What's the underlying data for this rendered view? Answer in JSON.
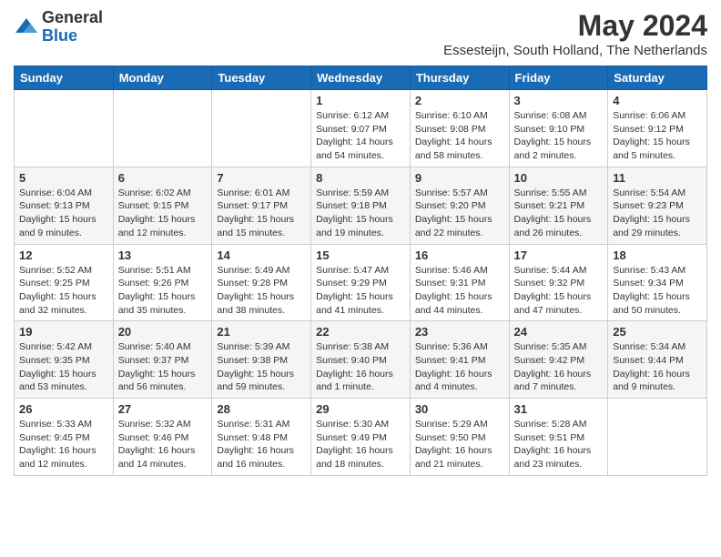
{
  "header": {
    "logo_line1": "General",
    "logo_line2": "Blue",
    "month_title": "May 2024",
    "location": "Essesteijn, South Holland, The Netherlands"
  },
  "days_of_week": [
    "Sunday",
    "Monday",
    "Tuesday",
    "Wednesday",
    "Thursday",
    "Friday",
    "Saturday"
  ],
  "weeks": [
    [
      {
        "day": "",
        "info": ""
      },
      {
        "day": "",
        "info": ""
      },
      {
        "day": "",
        "info": ""
      },
      {
        "day": "1",
        "info": "Sunrise: 6:12 AM\nSunset: 9:07 PM\nDaylight: 14 hours\nand 54 minutes."
      },
      {
        "day": "2",
        "info": "Sunrise: 6:10 AM\nSunset: 9:08 PM\nDaylight: 14 hours\nand 58 minutes."
      },
      {
        "day": "3",
        "info": "Sunrise: 6:08 AM\nSunset: 9:10 PM\nDaylight: 15 hours\nand 2 minutes."
      },
      {
        "day": "4",
        "info": "Sunrise: 6:06 AM\nSunset: 9:12 PM\nDaylight: 15 hours\nand 5 minutes."
      }
    ],
    [
      {
        "day": "5",
        "info": "Sunrise: 6:04 AM\nSunset: 9:13 PM\nDaylight: 15 hours\nand 9 minutes."
      },
      {
        "day": "6",
        "info": "Sunrise: 6:02 AM\nSunset: 9:15 PM\nDaylight: 15 hours\nand 12 minutes."
      },
      {
        "day": "7",
        "info": "Sunrise: 6:01 AM\nSunset: 9:17 PM\nDaylight: 15 hours\nand 15 minutes."
      },
      {
        "day": "8",
        "info": "Sunrise: 5:59 AM\nSunset: 9:18 PM\nDaylight: 15 hours\nand 19 minutes."
      },
      {
        "day": "9",
        "info": "Sunrise: 5:57 AM\nSunset: 9:20 PM\nDaylight: 15 hours\nand 22 minutes."
      },
      {
        "day": "10",
        "info": "Sunrise: 5:55 AM\nSunset: 9:21 PM\nDaylight: 15 hours\nand 26 minutes."
      },
      {
        "day": "11",
        "info": "Sunrise: 5:54 AM\nSunset: 9:23 PM\nDaylight: 15 hours\nand 29 minutes."
      }
    ],
    [
      {
        "day": "12",
        "info": "Sunrise: 5:52 AM\nSunset: 9:25 PM\nDaylight: 15 hours\nand 32 minutes."
      },
      {
        "day": "13",
        "info": "Sunrise: 5:51 AM\nSunset: 9:26 PM\nDaylight: 15 hours\nand 35 minutes."
      },
      {
        "day": "14",
        "info": "Sunrise: 5:49 AM\nSunset: 9:28 PM\nDaylight: 15 hours\nand 38 minutes."
      },
      {
        "day": "15",
        "info": "Sunrise: 5:47 AM\nSunset: 9:29 PM\nDaylight: 15 hours\nand 41 minutes."
      },
      {
        "day": "16",
        "info": "Sunrise: 5:46 AM\nSunset: 9:31 PM\nDaylight: 15 hours\nand 44 minutes."
      },
      {
        "day": "17",
        "info": "Sunrise: 5:44 AM\nSunset: 9:32 PM\nDaylight: 15 hours\nand 47 minutes."
      },
      {
        "day": "18",
        "info": "Sunrise: 5:43 AM\nSunset: 9:34 PM\nDaylight: 15 hours\nand 50 minutes."
      }
    ],
    [
      {
        "day": "19",
        "info": "Sunrise: 5:42 AM\nSunset: 9:35 PM\nDaylight: 15 hours\nand 53 minutes."
      },
      {
        "day": "20",
        "info": "Sunrise: 5:40 AM\nSunset: 9:37 PM\nDaylight: 15 hours\nand 56 minutes."
      },
      {
        "day": "21",
        "info": "Sunrise: 5:39 AM\nSunset: 9:38 PM\nDaylight: 15 hours\nand 59 minutes."
      },
      {
        "day": "22",
        "info": "Sunrise: 5:38 AM\nSunset: 9:40 PM\nDaylight: 16 hours\nand 1 minute."
      },
      {
        "day": "23",
        "info": "Sunrise: 5:36 AM\nSunset: 9:41 PM\nDaylight: 16 hours\nand 4 minutes."
      },
      {
        "day": "24",
        "info": "Sunrise: 5:35 AM\nSunset: 9:42 PM\nDaylight: 16 hours\nand 7 minutes."
      },
      {
        "day": "25",
        "info": "Sunrise: 5:34 AM\nSunset: 9:44 PM\nDaylight: 16 hours\nand 9 minutes."
      }
    ],
    [
      {
        "day": "26",
        "info": "Sunrise: 5:33 AM\nSunset: 9:45 PM\nDaylight: 16 hours\nand 12 minutes."
      },
      {
        "day": "27",
        "info": "Sunrise: 5:32 AM\nSunset: 9:46 PM\nDaylight: 16 hours\nand 14 minutes."
      },
      {
        "day": "28",
        "info": "Sunrise: 5:31 AM\nSunset: 9:48 PM\nDaylight: 16 hours\nand 16 minutes."
      },
      {
        "day": "29",
        "info": "Sunrise: 5:30 AM\nSunset: 9:49 PM\nDaylight: 16 hours\nand 18 minutes."
      },
      {
        "day": "30",
        "info": "Sunrise: 5:29 AM\nSunset: 9:50 PM\nDaylight: 16 hours\nand 21 minutes."
      },
      {
        "day": "31",
        "info": "Sunrise: 5:28 AM\nSunset: 9:51 PM\nDaylight: 16 hours\nand 23 minutes."
      },
      {
        "day": "",
        "info": ""
      }
    ]
  ]
}
